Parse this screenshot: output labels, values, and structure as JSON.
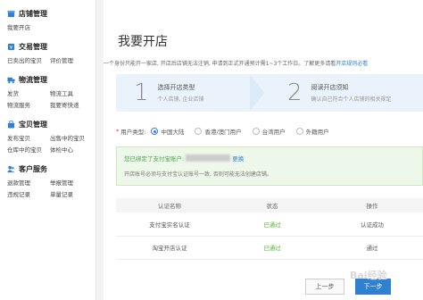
{
  "sidebar": {
    "sections": [
      {
        "icon": "store-icon",
        "title": "店铺管理",
        "links": [
          "我要开店"
        ]
      },
      {
        "icon": "trade-icon",
        "title": "交易管理",
        "links": [
          "已卖出的宝贝",
          "评价管理"
        ]
      },
      {
        "icon": "truck-icon",
        "title": "物流管理",
        "links": [
          "发货",
          "物流工具",
          "物流服务",
          "我要寄快递"
        ]
      },
      {
        "icon": "bag-icon",
        "title": "宝贝管理",
        "links": [
          "发布宝贝",
          "出售中的宝贝",
          "仓库中的宝贝",
          "体检中心"
        ]
      },
      {
        "icon": "customer-icon",
        "title": "客户服务",
        "links": [
          "退款管理",
          "举报管理",
          "违规记录",
          "单量记录"
        ]
      }
    ]
  },
  "main": {
    "title": "我要开店",
    "notice": "一个身份只能开一家店, 开店后店铺无法注销, 申请到正式开通预计需1~3个工作日。了解更多请看",
    "notice_link": "开店规则必看",
    "steps": [
      {
        "num": "1",
        "title": "选择开店类型",
        "sub": "个人店铺, 企业店铺"
      },
      {
        "num": "2",
        "title": "阅读开店须知",
        "sub": "确认自己符合个人店铺的相关规定"
      }
    ],
    "user_type": {
      "label": "用户类型:",
      "options": [
        "中国大陆",
        "香港/澳门用户",
        "台湾用户",
        "外籍用户"
      ],
      "selected": 0
    },
    "alipay": {
      "bound_prefix": "您已绑定了支付宝账户:",
      "change_link": "更换",
      "tip": "开店账号必须与支付宝认证账号一致, 否则可能无法创建店铺。"
    },
    "table": {
      "headers": [
        "认证名称",
        "状态",
        "操作"
      ],
      "rows": [
        {
          "name": "支付宝实名认证",
          "status": "已通过",
          "action": "认证成功"
        },
        {
          "name": "淘宝开店认证",
          "status": "已通过",
          "action": "通过"
        }
      ]
    },
    "buttons": {
      "prev": "上一步",
      "next": "下一步"
    },
    "watermark": "Bai经验"
  },
  "colors": {
    "accent": "#2f80d1",
    "success": "#5db33a",
    "step_bg": "#eaf3fb"
  }
}
